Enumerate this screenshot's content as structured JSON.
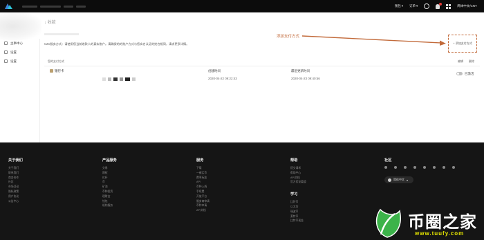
{
  "topbar": {
    "account": "钱包",
    "orders": "订单",
    "user": "A",
    "language": "简体中文/CNY"
  },
  "page": {
    "title": "↓ 收款"
  },
  "sidebar": {
    "items": [
      {
        "label": "主事中心",
        "icon": "doc-icon"
      },
      {
        "label": "设置",
        "icon": "settings-icon"
      },
      {
        "label": "设置",
        "icon": "list-icon"
      }
    ]
  },
  "notice": "C2C服务方式：请使用您当前收款人的真实账户。请确保的的账户方式与您实名认证的姓名相同，请求更多详情。",
  "annotation": "添加支付方式",
  "add_payment_button": "+ 添加支付方式",
  "table": {
    "header_label": "您的支付方式",
    "actions": [
      "编辑",
      "删除"
    ],
    "row": {
      "method": "银行卡",
      "created_label": "创建时间",
      "created_value": "2020-04-22 09:22:43",
      "updated_label": "最近更新时间",
      "updated_value": "2020-04-23 09:40:56",
      "status": "已激活"
    }
  },
  "footer": {
    "columns": [
      {
        "title": "关于我们",
        "links": [
          "关于我们",
          "联系我们",
          "商务合作",
          "社区",
          "市场活动",
          "隐私政策",
          "用户协议",
          "公告中心"
        ]
      },
      {
        "title": "产品服务",
        "links": [
          "交易",
          "期权",
          "杠杆",
          "币",
          "矿池",
          "币种投资",
          "理财宝",
          "钱包",
          "机构服务"
        ]
      },
      {
        "title": "服务",
        "links": [
          "下载",
          "一键买币",
          "费率标准",
          "API",
          "币种上线",
          "手续费",
          "开放平台",
          "服务商申请",
          "币种申请",
          "API文档"
        ]
      },
      {
        "title": "帮助",
        "links": [
          "提交请求",
          "帮助中心",
          "API文档",
          "官方验证渠道"
        ]
      },
      {
        "title": "学习",
        "links": [
          "比特币",
          "以太坊",
          "瑞波币",
          "莱特币",
          "比特币现金"
        ]
      }
    ],
    "social_title": "社区",
    "language_button": "简体中文"
  },
  "watermark": {
    "name": "币圈之家",
    "url": "www.tuufy.com"
  },
  "colors": {
    "accent": "#c26a3a",
    "footer_bg": "#151515",
    "topbar_bg": "#0c0c0c"
  }
}
